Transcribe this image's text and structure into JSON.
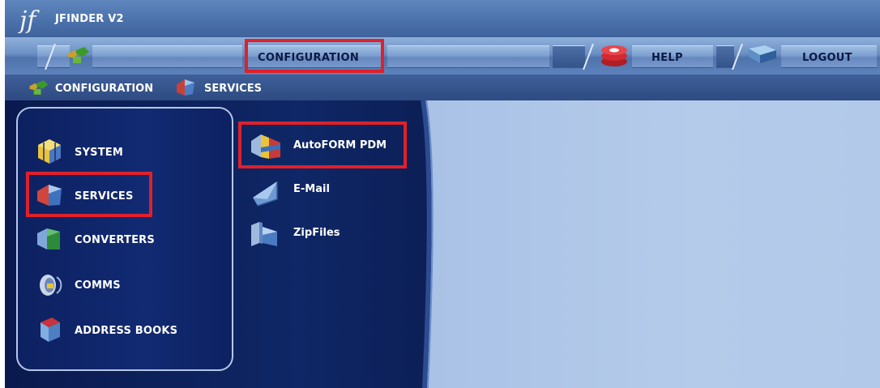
{
  "app": {
    "title": "JFINDER V2"
  },
  "menubar": {
    "configuration_label": "CONFIGURATION",
    "help_label": "HELP",
    "logout_label": "LOGOUT"
  },
  "breadcrumb": {
    "items": [
      "CONFIGURATION",
      "SERVICES"
    ]
  },
  "categories": [
    {
      "label": "SYSTEM",
      "icon": "system-cube-icon"
    },
    {
      "label": "SERVICES",
      "icon": "services-icon",
      "selected": true
    },
    {
      "label": "CONVERTERS",
      "icon": "converters-icon"
    },
    {
      "label": "COMMS",
      "icon": "comms-icon"
    },
    {
      "label": "ADDRESS BOOKS",
      "icon": "address-book-icon"
    }
  ],
  "services": [
    {
      "label": "AutoFORM PDM",
      "icon": "autoform-icon",
      "highlighted": true
    },
    {
      "label": "E-Mail",
      "icon": "email-icon"
    },
    {
      "label": "ZipFiles",
      "icon": "zipfiles-icon"
    }
  ],
  "colors": {
    "highlight": "#e0202a",
    "menu_text": "#0b1a44",
    "panel_dark": "#0d2161",
    "content_bg": "#b5cbea"
  }
}
